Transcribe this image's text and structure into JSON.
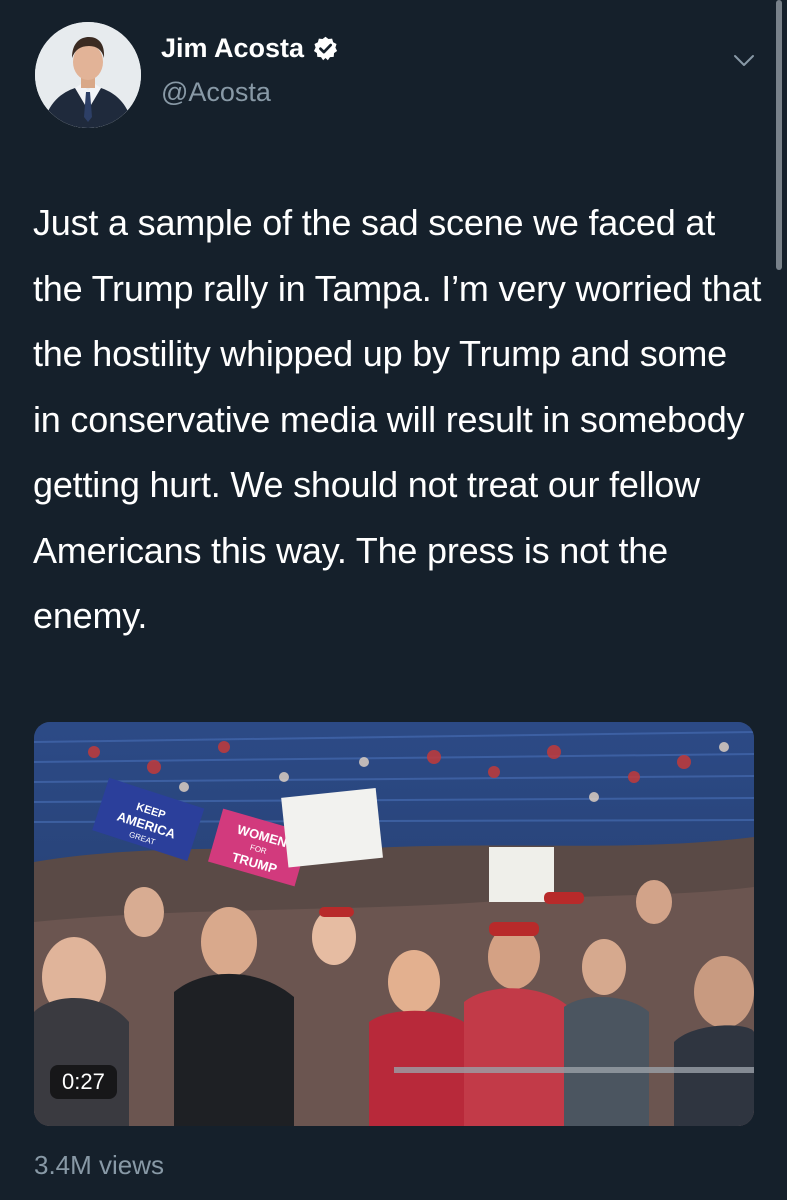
{
  "author": {
    "name": "Jim Acosta",
    "handle": "@Acosta",
    "verified": true,
    "avatar_icon": "profile-photo"
  },
  "tweet": {
    "text": "Just a sample of the sad scene we faced at the Trump rally in Tampa. I’m very worried that the hostility whipped up by Trump and some in conservative media will result in somebody getting hurt. We should not treat our fellow Americans this way. The press is not the enemy."
  },
  "media": {
    "type": "video",
    "duration": "0:27",
    "signs": {
      "keep_america_great": "KEEP AMERICA GREAT",
      "women_for_trump": "WOMEN FOR TRUMP"
    }
  },
  "stats": {
    "views": "3.4M views"
  },
  "colors": {
    "background": "#15202b",
    "secondary_text": "#8899a6",
    "verified_badge": "#ffffff"
  }
}
